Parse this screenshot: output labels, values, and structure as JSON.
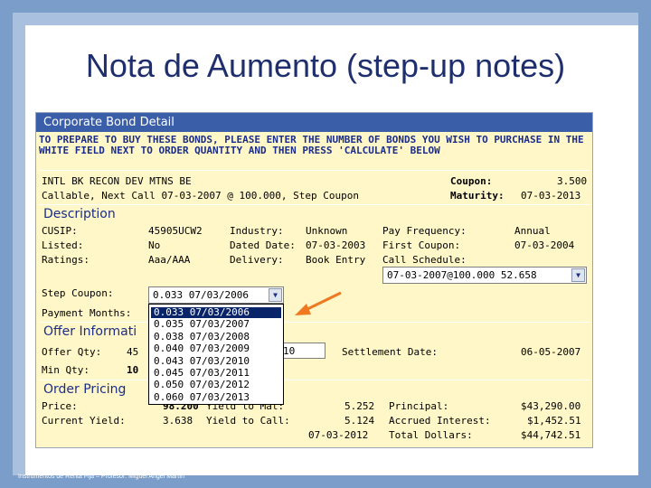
{
  "slide": {
    "title": "Nota de Aumento (step-up notes)",
    "footer": "Instrumentos de Renta Fija – Profesor: Miguel Angel Martín"
  },
  "panel": {
    "header": "Corporate Bond Detail",
    "instructions": "TO PREPARE TO BUY THESE BONDS, PLEASE ENTER THE NUMBER OF BONDS YOU WISH TO PURCHASE IN THE WHITE FIELD NEXT TO ORDER QUANTITY AND THEN PRESS 'CALCULATE' BELOW"
  },
  "bond": {
    "name": "INTL BK RECON DEV MTNS BE",
    "subtitle": "Callable, Next Call 07-03-2007 @ 100.000, Step Coupon",
    "coupon_label": "Coupon:",
    "coupon_value": "3.500",
    "maturity_label": "Maturity:",
    "maturity_value": "07-03-2013"
  },
  "description": {
    "title": "Description",
    "cusip_label": "CUSIP:",
    "cusip_value": "45905UCW2",
    "listed_label": "Listed:",
    "listed_value": "No",
    "ratings_label": "Ratings:",
    "ratings_value": "Aaa/AAA",
    "industry_label": "Industry:",
    "industry_value": "Unknown",
    "dated_label": "Dated Date:",
    "dated_value": "07-03-2003",
    "delivery_label": "Delivery:",
    "delivery_value": "Book Entry",
    "pay_freq_label": "Pay Frequency:",
    "pay_freq_value": "Annual",
    "first_coupon_label": "First Coupon:",
    "first_coupon_value": "07-03-2004",
    "call_schedule_label": "Call Schedule:",
    "call_schedule_value": "07-03-2007@100.000 52.658",
    "step_coupon_label": "Step Coupon:",
    "step_coupon_value": "0.033 07/03/2006",
    "step_coupon_options": [
      "0.033 07/03/2006",
      "0.035 07/03/2007",
      "0.038 07/03/2008",
      "0.040 07/03/2009",
      "0.043 07/03/2010",
      "0.045 07/03/2011",
      "0.050 07/03/2012",
      "0.060 07/03/2013"
    ],
    "payment_months_label": "Payment Months:"
  },
  "offer": {
    "title": "Offer Informati",
    "offer_qty_label": "Offer Qty:",
    "offer_qty_value": "45",
    "min_qty_label": "Min Qty:",
    "min_qty_value": "10",
    "order_qty_value": "10",
    "settlement_label": "Settlement Date:",
    "settlement_value": "06-05-2007"
  },
  "pricing": {
    "title": "Order Pricing",
    "price_label": "Price:",
    "price_value": "98.200",
    "current_yield_label": "Current Yield:",
    "current_yield_value": "3.638",
    "ytm_label": "Yield to Mat:",
    "ytm_value": "5.252",
    "ytc_label": "Yield to Call:",
    "ytc_value": "5.124",
    "call_date_value": "07-03-2012",
    "principal_label": "Principal:",
    "principal_value": "$43,290.00",
    "accrued_label": "Accrued Interest:",
    "accrued_value": "$1,452.51",
    "total_label": "Total Dollars:",
    "total_value": "$44,742.51"
  },
  "colors": {
    "header_blue": "#3b5ea8",
    "panel_yellow": "#fff7c8",
    "arrow_orange": "#f07820",
    "selection_navy": "#0a246a"
  }
}
